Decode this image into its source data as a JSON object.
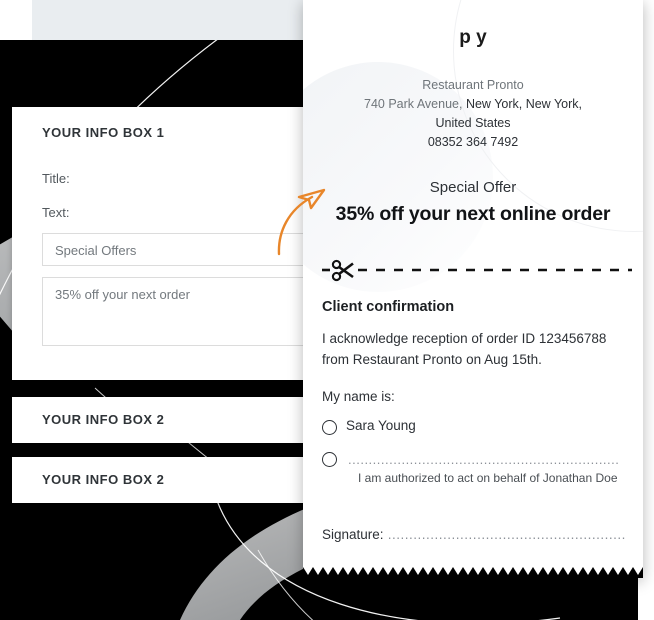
{
  "window": {
    "topbar": {
      "knob_icon": "camera-dot-icon"
    },
    "background_color": "#000000",
    "accent_color": "#e8862a"
  },
  "form": {
    "box1": {
      "heading": "YOUR INFO BOX 1",
      "title_label": "Title:",
      "text_label": "Text:",
      "title_input_value": "Special Offers",
      "text_input_value": "35% off your next order"
    },
    "box2": {
      "heading": "YOUR INFO BOX 2"
    },
    "box3": {
      "heading": "YOUR INFO BOX 2"
    }
  },
  "receipt": {
    "clipped_heading": "p        y",
    "business_name": "Restaurant Pronto",
    "address_line1_gray": "740 Park Avenue,",
    "address_line1_dark": " New York, New York,",
    "address_line2": "United States",
    "phone": "08352 364 7492",
    "offer_label": "Special Offer",
    "offer_headline": "35% off your next online order",
    "scissors_icon": "scissors-icon",
    "confirmation_title": "Client confirmation",
    "confirmation_body": "I acknowledge reception of order ID 123456788 from Restaurant Pronto on Aug 15th.",
    "name_prompt": "My name is:",
    "options": [
      {
        "label": "Sara Young",
        "type": "name",
        "selected": false
      },
      {
        "label": "",
        "dots": "..................................................................",
        "sub": "I am authorized to act on behalf of Jonathan Doe",
        "type": "blank",
        "selected": false
      }
    ],
    "signature_label": "Signature:",
    "signature_dots": " ..........................................................."
  }
}
